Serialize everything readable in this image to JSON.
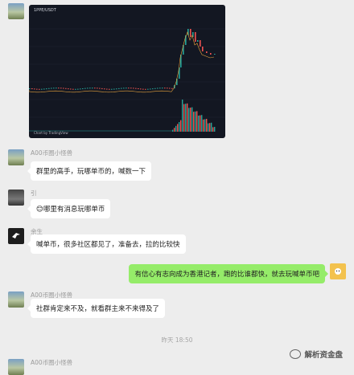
{
  "chart_image": {
    "title": "1PPE/USDT",
    "brand": "Chart by TradingView"
  },
  "messages": [
    {
      "sender": "A00币圈小怪兽",
      "text": "群里的高手，玩哪单币的，喊数一下"
    },
    {
      "sender": "引",
      "text": "😊哪里有消息玩哪单币"
    },
    {
      "sender": "余生",
      "text": "喊单币，很多社区都见了，准备去，拉的比较快"
    },
    {
      "sender": "",
      "text": "有信心有志向成为香港记者，跑的比谁都快，就去玩喊单币吧"
    },
    {
      "sender": "A00币圈小怪兽",
      "text": "社群肯定来不及，就看群主来不来得及了"
    },
    {
      "sender": "A00币圈小怪兽",
      "text": ""
    }
  ],
  "timestamp": "昨天 18:50",
  "watermark": "解析资金盘",
  "colors": {
    "bubble_green": "#95ec69",
    "chart_bg": "#131722",
    "candle_up": "#26a69a",
    "candle_down": "#ef5350"
  }
}
